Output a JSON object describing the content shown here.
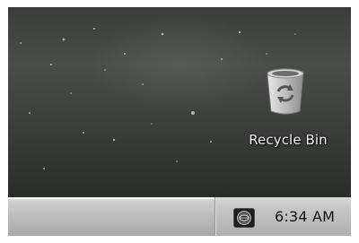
{
  "desktop": {
    "icons": [
      {
        "label": "Recycle Bin",
        "icon": "recycle-bin-icon"
      }
    ]
  },
  "taskbar": {
    "tray": {
      "icon": "security-shield-icon",
      "clock": "6:34 AM"
    }
  }
}
